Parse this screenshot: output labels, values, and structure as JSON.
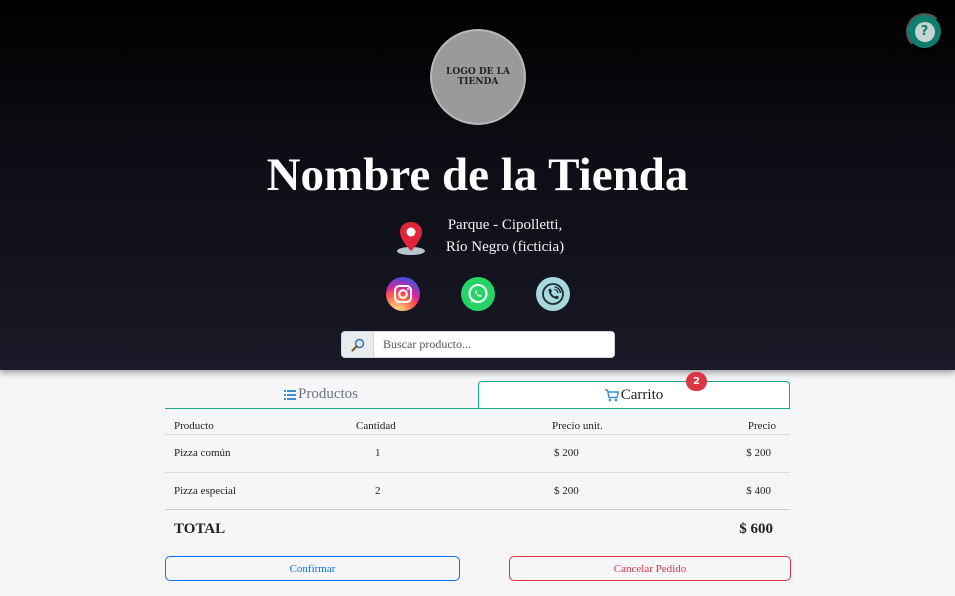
{
  "header": {
    "logo_text": "LOGO DE LA TIENDA",
    "title": "Nombre de la Tienda",
    "address_line1": "Parque - Cipolletti,",
    "address_line2": "Río Negro (ficticia)",
    "social": [
      "instagram-icon",
      "whatsapp-icon",
      "phone-icon"
    ]
  },
  "search": {
    "placeholder": "Buscar producto...",
    "icon": "search-icon"
  },
  "help": {
    "label": "?"
  },
  "tabs": {
    "products_label": "Productos",
    "cart_label": "Carrito",
    "cart_badge": "2"
  },
  "cart_table": {
    "headers": [
      "Producto",
      "Cantidad",
      "Precio unit.",
      "Precio"
    ],
    "rows": [
      {
        "product": "Pizza común",
        "qty": "1",
        "unit_price": "$ 200",
        "price": "$ 200"
      },
      {
        "product": "Pizza especial",
        "qty": "2",
        "unit_price": "$ 200",
        "price": "$ 400"
      }
    ],
    "total_label": "TOTAL",
    "total_value": "$ 600"
  },
  "actions": {
    "confirm_label": "Confirmar",
    "cancel_label": "Cancelar Pedido"
  },
  "colors": {
    "accent": "#19a98a",
    "danger": "#dc3545",
    "primary": "#0d6efd",
    "help_bg": "#0e7f6e"
  }
}
